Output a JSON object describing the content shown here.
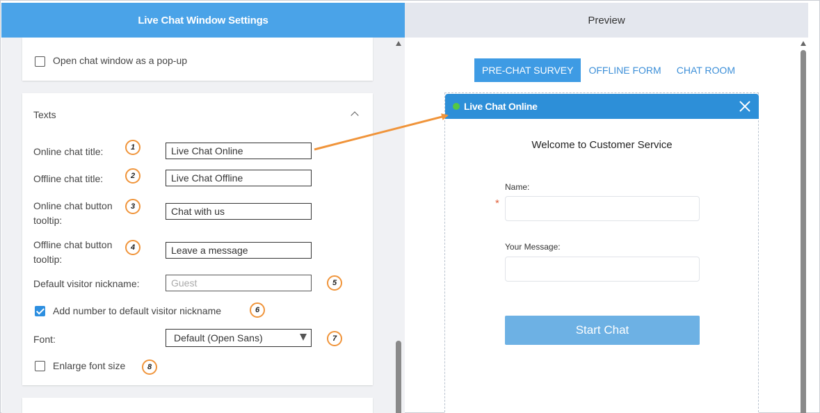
{
  "headers": {
    "settings": "Live Chat Window Settings",
    "preview": "Preview"
  },
  "settings": {
    "popup_label": "Open chat window as a pop-up",
    "popup_checked": false,
    "texts_section": {
      "title": "Texts",
      "online_title_label": "Online chat title:",
      "online_title_value": "Live Chat Online",
      "offline_title_label": "Offline chat title:",
      "offline_title_value": "Live Chat Offline",
      "online_tooltip_label": "Online chat button tooltip:",
      "online_tooltip_value": "Chat with us",
      "offline_tooltip_label": "Offline chat button tooltip:",
      "offline_tooltip_value": "Leave a message",
      "nickname_label": "Default visitor nickname:",
      "nickname_placeholder": "Guest",
      "add_number_label": "Add number to default visitor nickname",
      "add_number_checked": true,
      "font_label": "Font:",
      "font_value": "Default (Open Sans)",
      "enlarge_label": "Enlarge font size",
      "enlarge_checked": false
    },
    "badges": [
      "1",
      "2",
      "3",
      "4",
      "5",
      "6",
      "7",
      "8"
    ]
  },
  "preview": {
    "tabs": [
      "PRE-CHAT SURVEY",
      "OFFLINE FORM",
      "CHAT ROOM"
    ],
    "active_tab": "PRE-CHAT SURVEY",
    "chat_title": "Live Chat Online",
    "welcome": "Welcome to Customer Service",
    "name_label": "Name:",
    "required_mark": "*",
    "message_label": "Your Message:",
    "start_button": "Start Chat"
  },
  "colors": {
    "accent": "#4aa3e8",
    "chat_header": "#2d8fd8",
    "start_button": "#6db1e4",
    "badge_ring": "#f0943a",
    "online_dot": "#54c843"
  },
  "icons": [
    "close-icon",
    "chevron-up-icon",
    "online-dot-icon",
    "dropdown-arrow-icon",
    "arrow-annotation-icon"
  ]
}
